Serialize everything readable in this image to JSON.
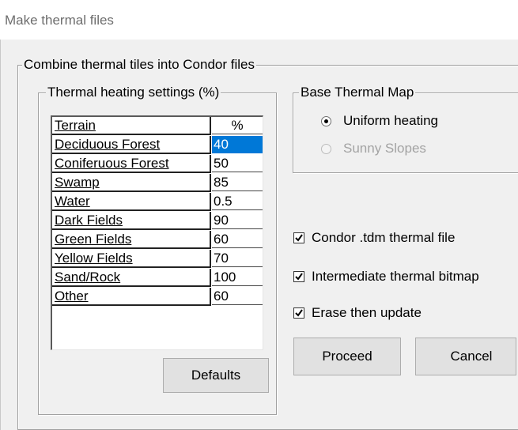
{
  "window": {
    "title": "Make thermal files"
  },
  "outer_group": {
    "legend": "Combine thermal tiles into Condor files"
  },
  "heating_group": {
    "legend": "Thermal heating settings (%)",
    "table": {
      "headers": {
        "terrain": "Terrain",
        "percent": "%"
      },
      "rows": [
        {
          "terrain": "Deciduous Forest",
          "percent": "40"
        },
        {
          "terrain": "Coniferuous Forest",
          "percent": "50"
        },
        {
          "terrain": "Swamp",
          "percent": "85"
        },
        {
          "terrain": "Water",
          "percent": "0.5"
        },
        {
          "terrain": "Dark Fields",
          "percent": "90"
        },
        {
          "terrain": "Green Fields",
          "percent": "60"
        },
        {
          "terrain": "Yellow Fields",
          "percent": "70"
        },
        {
          "terrain": "Sand/Rock",
          "percent": "100"
        },
        {
          "terrain": "Other",
          "percent": "60"
        }
      ],
      "selected_row": 0
    },
    "defaults_label": "Defaults"
  },
  "base_map_group": {
    "legend": "Base Thermal Map",
    "options": [
      {
        "label": "Uniform heating",
        "selected": true,
        "enabled": true
      },
      {
        "label": "Sunny Slopes",
        "selected": false,
        "enabled": false
      }
    ]
  },
  "checkboxes": [
    {
      "label": "Condor .tdm thermal file",
      "checked": true
    },
    {
      "label": "Intermediate thermal bitmap",
      "checked": true
    },
    {
      "label": "Erase then update",
      "checked": true
    }
  ],
  "buttons": {
    "proceed": "Proceed",
    "cancel": "Cancel"
  },
  "colors": {
    "selection": "#0078d7",
    "background": "#f0f0f0"
  }
}
